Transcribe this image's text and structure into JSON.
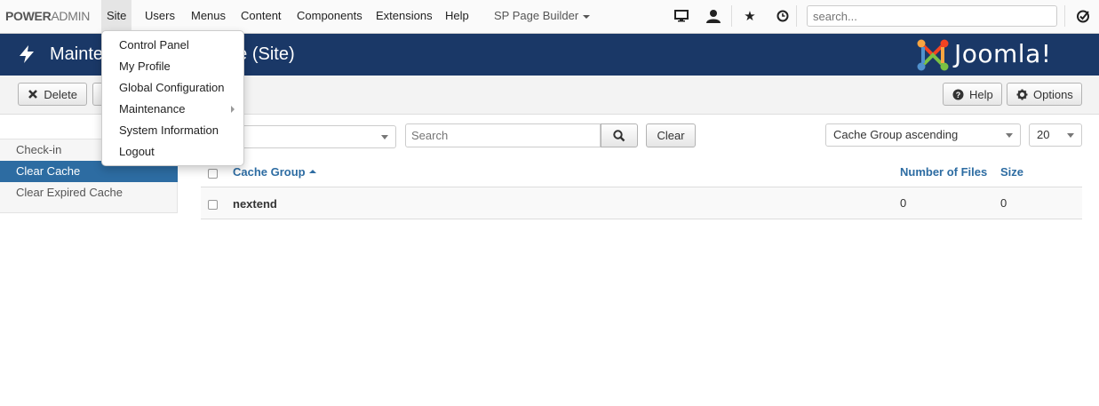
{
  "navbar": {
    "brand_bold": "POWER",
    "brand_light": "ADMIN",
    "menu": [
      "Site",
      "Users",
      "Menus",
      "Content",
      "Components",
      "Extensions",
      "Help"
    ],
    "page_builder": "SP Page Builder",
    "search_placeholder": "search..."
  },
  "header": {
    "title_left": "Mainte",
    "title_right": "ne (Site)",
    "logo_text": "Joomla!"
  },
  "toolbar": {
    "delete_label": "Delete",
    "help_label": "Help",
    "options_label": "Options"
  },
  "sidebar": {
    "items": [
      {
        "label": "Check-in",
        "active": false
      },
      {
        "label": "Clear Cache",
        "active": true
      },
      {
        "label": "Clear Expired Cache",
        "active": false
      }
    ]
  },
  "filters": {
    "search_placeholder": "Search",
    "clear_label": "Clear",
    "sort_value": "Cache Group ascending",
    "limit_value": "20"
  },
  "table": {
    "headers": {
      "group": "Cache Group",
      "files": "Number of Files",
      "size": "Size"
    },
    "rows": [
      {
        "group": "nextend",
        "files": "0",
        "size": "0"
      }
    ]
  },
  "dropdown": {
    "items": [
      "Control Panel",
      "My Profile",
      "Global Configuration",
      "Maintenance",
      "System Information",
      "Logout"
    ]
  },
  "colors": {
    "header_bg": "#1a3867",
    "active_blue": "#2d6ca2"
  }
}
